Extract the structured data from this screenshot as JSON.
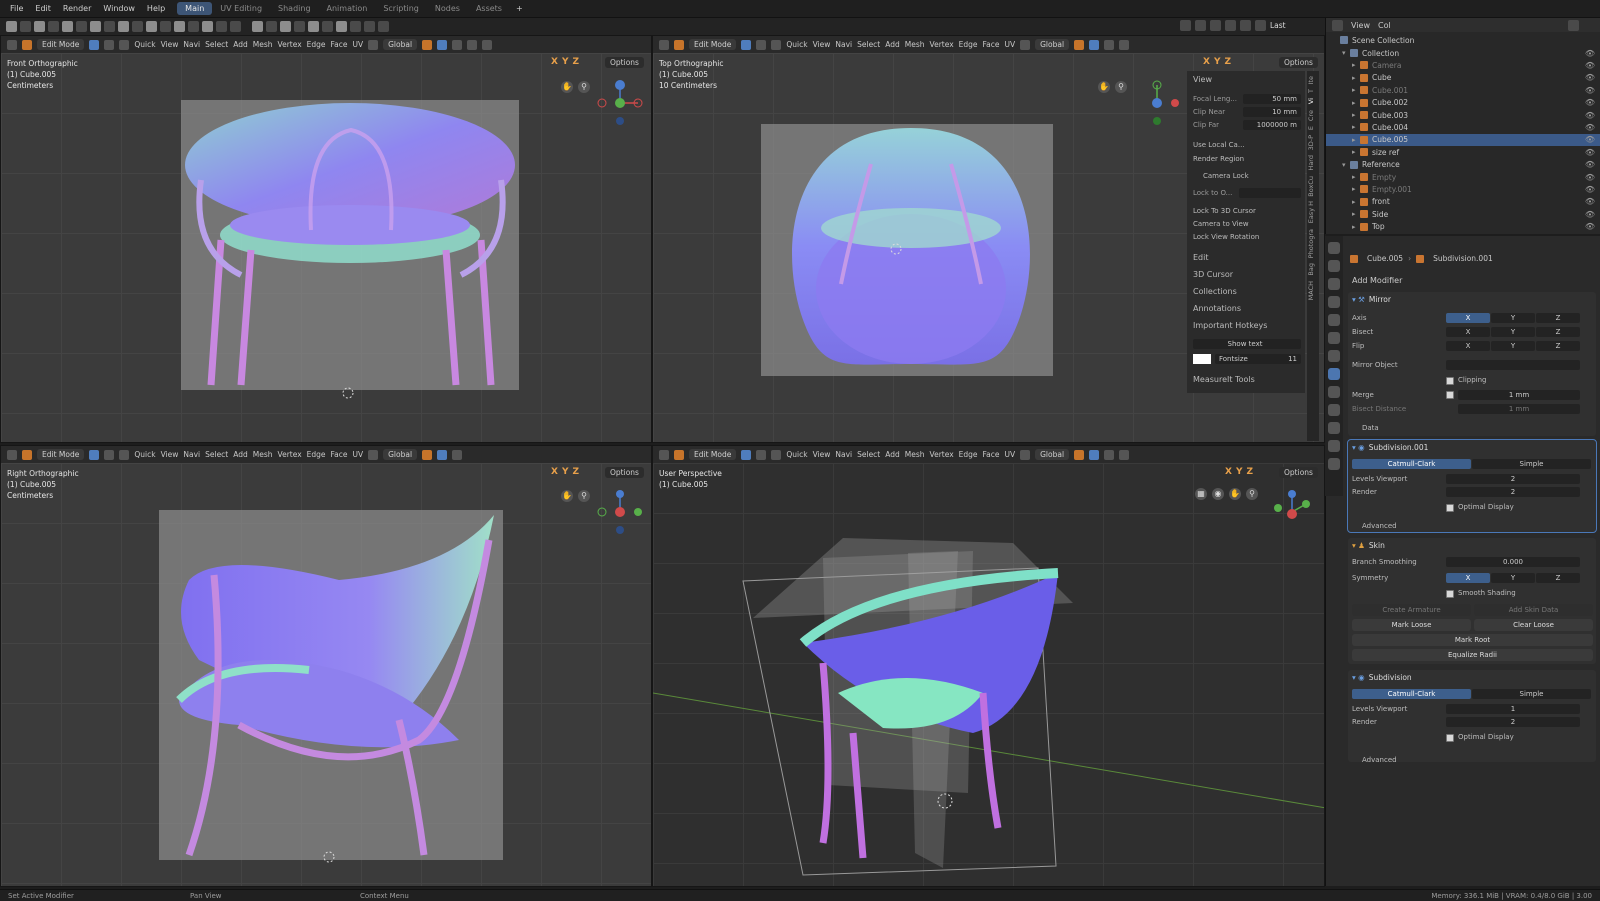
{
  "topbar": {
    "menus": [
      "File",
      "Edit",
      "Render",
      "Window",
      "Help"
    ],
    "workspaces": [
      "Main",
      "UV Editing",
      "Shading",
      "Animation",
      "Scripting",
      "Nodes",
      "Assets"
    ],
    "active_workspace": "Main",
    "add_tab": "+"
  },
  "toolbar_right": {
    "last_label": "Last"
  },
  "viewport_header": {
    "mode": "Edit Mode",
    "menus": [
      "Quick",
      "View",
      "Navi",
      "Select",
      "Add",
      "Mesh",
      "Vertex",
      "Edge",
      "Face",
      "UV"
    ],
    "orientation": "Global",
    "axes": [
      "X",
      "Y",
      "Z"
    ],
    "options": "Options"
  },
  "viewports": {
    "front": {
      "line1": "Front Orthographic",
      "line2": "(1) Cube.005",
      "line3": "Centimeters"
    },
    "top": {
      "line1": "Top Orthographic",
      "line2": "(1) Cube.005",
      "line3": "10 Centimeters"
    },
    "right": {
      "line1": "Right Orthographic",
      "line2": "(1) Cube.005",
      "line3": "Centimeters"
    },
    "persp": {
      "line1": "User Perspective",
      "line2": "(1) Cube.005"
    }
  },
  "npanel": {
    "view_title": "View",
    "focal_label": "Focal Leng...",
    "focal_value": "50 mm",
    "clip_near_label": "Clip Near",
    "clip_near_value": "10 mm",
    "clip_far_label": "Clip Far",
    "clip_far_value": "1000000 m",
    "use_local": "Use Local Ca...",
    "render_region": "Render Region",
    "camera_lock": "Camera Lock",
    "lock_to": "Lock to O...",
    "lock_cursor": "Lock To 3D Cursor",
    "camera_to_view": "Camera to View",
    "lock_rotation": "Lock View Rotation",
    "sections": [
      "Edit",
      "3D Cursor",
      "Collections",
      "Annotations"
    ],
    "hotkeys": "Important Hotkeys",
    "show_text": "Show text",
    "fontsize_label": "Fontsize",
    "fontsize_value": "11",
    "measureit": "MeasureIt Tools",
    "tabs": [
      "Ite",
      "T",
      "Vi",
      "Cre",
      "E",
      "3D-P",
      "Hard",
      "BoxCu",
      "Easy H",
      "Photogra",
      "Bag",
      "MACH"
    ]
  },
  "outliner": {
    "header_items": [
      "View",
      "Col"
    ],
    "scene": "Scene Collection",
    "rows": [
      {
        "name": "Collection",
        "indent": 1,
        "type": "c",
        "sel": false,
        "dim": false
      },
      {
        "name": "Camera",
        "indent": 2,
        "type": "o",
        "sel": false,
        "dim": true
      },
      {
        "name": "Cube",
        "indent": 2,
        "type": "o",
        "sel": false,
        "dim": false
      },
      {
        "name": "Cube.001",
        "indent": 2,
        "type": "o",
        "sel": false,
        "dim": true
      },
      {
        "name": "Cube.002",
        "indent": 2,
        "type": "o",
        "sel": false,
        "dim": false
      },
      {
        "name": "Cube.003",
        "indent": 2,
        "type": "o",
        "sel": false,
        "dim": false
      },
      {
        "name": "Cube.004",
        "indent": 2,
        "type": "o",
        "sel": false,
        "dim": false
      },
      {
        "name": "Cube.005",
        "indent": 2,
        "type": "o",
        "sel": true,
        "dim": false
      },
      {
        "name": "size ref",
        "indent": 2,
        "type": "o",
        "sel": false,
        "dim": false
      },
      {
        "name": "Reference",
        "indent": 1,
        "type": "c",
        "sel": false,
        "dim": false
      },
      {
        "name": "Empty",
        "indent": 2,
        "type": "o",
        "sel": false,
        "dim": true
      },
      {
        "name": "Empty.001",
        "indent": 2,
        "type": "o",
        "sel": false,
        "dim": true
      },
      {
        "name": "front",
        "indent": 2,
        "type": "o",
        "sel": false,
        "dim": false
      },
      {
        "name": "Side",
        "indent": 2,
        "type": "o",
        "sel": false,
        "dim": false
      },
      {
        "name": "Top",
        "indent": 2,
        "type": "o",
        "sel": false,
        "dim": false
      }
    ]
  },
  "properties": {
    "breadcrumb_obj": "Cube.005",
    "breadcrumb_mod": "Subdivision.001",
    "add_modifier": "Add Modifier",
    "mirror": {
      "title": "Mirror",
      "axis": "Axis",
      "bisect": "Bisect",
      "flip": "Flip",
      "mirror_object": "Mirror Object",
      "clipping": "Clipping",
      "merge": "Merge",
      "merge_value": "1 mm",
      "bisect_distance": "Bisect Distance",
      "bisect_distance_value": "1 mm",
      "data": "Data"
    },
    "subdiv1": {
      "title": "Subdivision.001",
      "catmull": "Catmull-Clark",
      "simple": "Simple",
      "levels_viewport": "Levels Viewport",
      "levels_value": "2",
      "render": "Render",
      "render_value": "2",
      "optimal": "Optimal Display",
      "advanced": "Advanced"
    },
    "skin": {
      "title": "Skin",
      "branch": "Branch Smoothing",
      "branch_value": "0.000",
      "symmetry": "Symmetry",
      "smooth": "Smooth Shading",
      "create_armature": "Create Armature",
      "add_skin": "Add Skin Data",
      "mark_loose": "Mark Loose",
      "clear_loose": "Clear Loose",
      "mark_root": "Mark Root",
      "equalize": "Equalize Radii"
    },
    "subdiv2": {
      "title": "Subdivision",
      "catmull": "Catmull-Clark",
      "simple": "Simple",
      "levels_viewport": "Levels Viewport",
      "levels_value": "1",
      "render": "Render",
      "render_value": "2",
      "optimal": "Optimal Display",
      "advanced": "Advanced"
    }
  },
  "status": {
    "left1": "Set Active Modifier",
    "left2": "Pan View",
    "left3": "Context Menu",
    "right": "Memory: 336.1 MiB | VRAM: 0.4/8.0 GiB | 3.00"
  }
}
